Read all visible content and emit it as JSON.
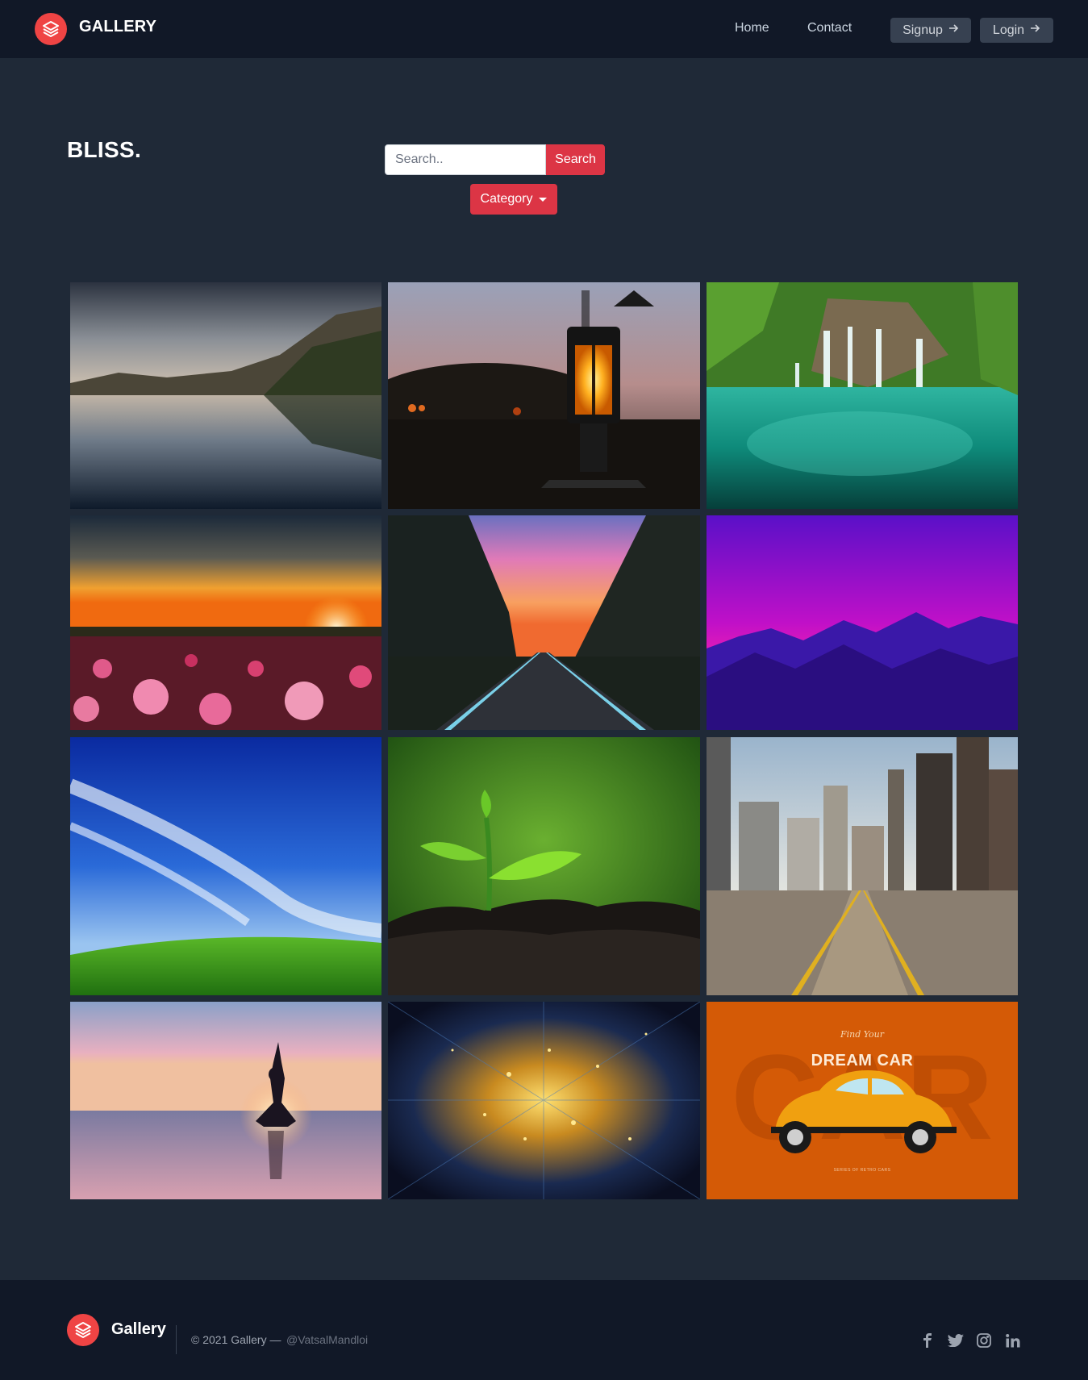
{
  "header": {
    "brand": "GALLERY",
    "nav": {
      "home": "Home",
      "contact": "Contact"
    },
    "signup_label": "Signup",
    "login_label": "Login"
  },
  "hero": {
    "title": "BLISS.",
    "search_placeholder": "Search..",
    "search_button": "Search",
    "category_button": "Category"
  },
  "gallery": {
    "images": [
      {
        "subject": "mountain-lake-reflection"
      },
      {
        "subject": "street-lantern-at-dusk"
      },
      {
        "subject": "tropical-waterfall-lagoon"
      },
      {
        "subject": "flower-field-sunset"
      },
      {
        "subject": "forest-road-pink-sky"
      },
      {
        "subject": "purple-mountain-range"
      },
      {
        "subject": "green-hill-blue-sky"
      },
      {
        "subject": "seedling-in-rain"
      },
      {
        "subject": "city-street-skyscrapers"
      },
      {
        "subject": "yoga-silhouette-beach"
      },
      {
        "subject": "golden-particle-burst"
      },
      {
        "subject": "dream-car-poster"
      }
    ],
    "poster_script": "Find Your",
    "poster_title": "DREAM CAR",
    "poster_caption": "SERIES OF RETRO CARS"
  },
  "footer": {
    "brand": "Gallery",
    "copyright": "© 2021 Gallery —",
    "handle": "@VatsalMandloi",
    "social": [
      "facebook-icon",
      "twitter-icon",
      "instagram-icon",
      "linkedin-icon"
    ]
  },
  "colors": {
    "accent": "#dc3545",
    "header_bg": "#111827",
    "page_bg": "#1f2937"
  }
}
